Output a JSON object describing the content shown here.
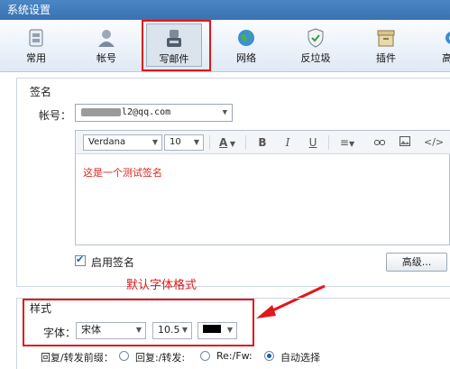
{
  "window": {
    "title": "系统设置"
  },
  "toolbar": {
    "items": [
      {
        "label": "常用",
        "icon": "general-icon"
      },
      {
        "label": "帐号",
        "icon": "account-icon"
      },
      {
        "label": "写邮件",
        "icon": "compose-icon",
        "active": true
      },
      {
        "label": "网络",
        "icon": "network-globe-icon"
      },
      {
        "label": "反垃圾",
        "icon": "shield-icon"
      },
      {
        "label": "插件",
        "icon": "plugin-box-icon"
      },
      {
        "label": "高",
        "icon": "advanced-gear-icon"
      }
    ]
  },
  "signature": {
    "section_title": "签名",
    "account_label": "帐号：",
    "account_value": "l2@qq.com",
    "editor": {
      "font_family": "Verdana",
      "font_size": "10",
      "content": "这是一个测试签名",
      "text_color": "#d9261c"
    },
    "enable_label": "启用签名",
    "enable_checked": true,
    "advanced_button": "高级..."
  },
  "annotation": {
    "text": "默认字体格式",
    "color": "#e0181a"
  },
  "style": {
    "section_title": "样式",
    "font_label": "字体：",
    "font_family": "宋体",
    "font_size": "10.5",
    "font_color": "#000000"
  },
  "reply_prefix": {
    "label": "回复/转发前缀：",
    "options": [
      {
        "label": "回复:/转发:",
        "selected": false
      },
      {
        "label": "Re:/Fw:",
        "selected": false
      },
      {
        "label": "自动选择",
        "selected": true
      }
    ]
  }
}
